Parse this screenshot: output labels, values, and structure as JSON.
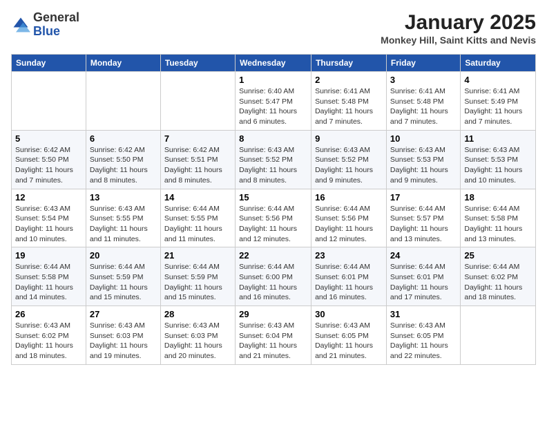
{
  "logo": {
    "general": "General",
    "blue": "Blue"
  },
  "header": {
    "month": "January 2025",
    "location": "Monkey Hill, Saint Kitts and Nevis"
  },
  "weekdays": [
    "Sunday",
    "Monday",
    "Tuesday",
    "Wednesday",
    "Thursday",
    "Friday",
    "Saturday"
  ],
  "weeks": [
    [
      {
        "day": "",
        "info": ""
      },
      {
        "day": "",
        "info": ""
      },
      {
        "day": "",
        "info": ""
      },
      {
        "day": "1",
        "info": "Sunrise: 6:40 AM\nSunset: 5:47 PM\nDaylight: 11 hours and 6 minutes."
      },
      {
        "day": "2",
        "info": "Sunrise: 6:41 AM\nSunset: 5:48 PM\nDaylight: 11 hours and 7 minutes."
      },
      {
        "day": "3",
        "info": "Sunrise: 6:41 AM\nSunset: 5:48 PM\nDaylight: 11 hours and 7 minutes."
      },
      {
        "day": "4",
        "info": "Sunrise: 6:41 AM\nSunset: 5:49 PM\nDaylight: 11 hours and 7 minutes."
      }
    ],
    [
      {
        "day": "5",
        "info": "Sunrise: 6:42 AM\nSunset: 5:50 PM\nDaylight: 11 hours and 7 minutes."
      },
      {
        "day": "6",
        "info": "Sunrise: 6:42 AM\nSunset: 5:50 PM\nDaylight: 11 hours and 8 minutes."
      },
      {
        "day": "7",
        "info": "Sunrise: 6:42 AM\nSunset: 5:51 PM\nDaylight: 11 hours and 8 minutes."
      },
      {
        "day": "8",
        "info": "Sunrise: 6:43 AM\nSunset: 5:52 PM\nDaylight: 11 hours and 8 minutes."
      },
      {
        "day": "9",
        "info": "Sunrise: 6:43 AM\nSunset: 5:52 PM\nDaylight: 11 hours and 9 minutes."
      },
      {
        "day": "10",
        "info": "Sunrise: 6:43 AM\nSunset: 5:53 PM\nDaylight: 11 hours and 9 minutes."
      },
      {
        "day": "11",
        "info": "Sunrise: 6:43 AM\nSunset: 5:53 PM\nDaylight: 11 hours and 10 minutes."
      }
    ],
    [
      {
        "day": "12",
        "info": "Sunrise: 6:43 AM\nSunset: 5:54 PM\nDaylight: 11 hours and 10 minutes."
      },
      {
        "day": "13",
        "info": "Sunrise: 6:43 AM\nSunset: 5:55 PM\nDaylight: 11 hours and 11 minutes."
      },
      {
        "day": "14",
        "info": "Sunrise: 6:44 AM\nSunset: 5:55 PM\nDaylight: 11 hours and 11 minutes."
      },
      {
        "day": "15",
        "info": "Sunrise: 6:44 AM\nSunset: 5:56 PM\nDaylight: 11 hours and 12 minutes."
      },
      {
        "day": "16",
        "info": "Sunrise: 6:44 AM\nSunset: 5:56 PM\nDaylight: 11 hours and 12 minutes."
      },
      {
        "day": "17",
        "info": "Sunrise: 6:44 AM\nSunset: 5:57 PM\nDaylight: 11 hours and 13 minutes."
      },
      {
        "day": "18",
        "info": "Sunrise: 6:44 AM\nSunset: 5:58 PM\nDaylight: 11 hours and 13 minutes."
      }
    ],
    [
      {
        "day": "19",
        "info": "Sunrise: 6:44 AM\nSunset: 5:58 PM\nDaylight: 11 hours and 14 minutes."
      },
      {
        "day": "20",
        "info": "Sunrise: 6:44 AM\nSunset: 5:59 PM\nDaylight: 11 hours and 15 minutes."
      },
      {
        "day": "21",
        "info": "Sunrise: 6:44 AM\nSunset: 5:59 PM\nDaylight: 11 hours and 15 minutes."
      },
      {
        "day": "22",
        "info": "Sunrise: 6:44 AM\nSunset: 6:00 PM\nDaylight: 11 hours and 16 minutes."
      },
      {
        "day": "23",
        "info": "Sunrise: 6:44 AM\nSunset: 6:01 PM\nDaylight: 11 hours and 16 minutes."
      },
      {
        "day": "24",
        "info": "Sunrise: 6:44 AM\nSunset: 6:01 PM\nDaylight: 11 hours and 17 minutes."
      },
      {
        "day": "25",
        "info": "Sunrise: 6:44 AM\nSunset: 6:02 PM\nDaylight: 11 hours and 18 minutes."
      }
    ],
    [
      {
        "day": "26",
        "info": "Sunrise: 6:43 AM\nSunset: 6:02 PM\nDaylight: 11 hours and 18 minutes."
      },
      {
        "day": "27",
        "info": "Sunrise: 6:43 AM\nSunset: 6:03 PM\nDaylight: 11 hours and 19 minutes."
      },
      {
        "day": "28",
        "info": "Sunrise: 6:43 AM\nSunset: 6:03 PM\nDaylight: 11 hours and 20 minutes."
      },
      {
        "day": "29",
        "info": "Sunrise: 6:43 AM\nSunset: 6:04 PM\nDaylight: 11 hours and 21 minutes."
      },
      {
        "day": "30",
        "info": "Sunrise: 6:43 AM\nSunset: 6:05 PM\nDaylight: 11 hours and 21 minutes."
      },
      {
        "day": "31",
        "info": "Sunrise: 6:43 AM\nSunset: 6:05 PM\nDaylight: 11 hours and 22 minutes."
      },
      {
        "day": "",
        "info": ""
      }
    ]
  ]
}
